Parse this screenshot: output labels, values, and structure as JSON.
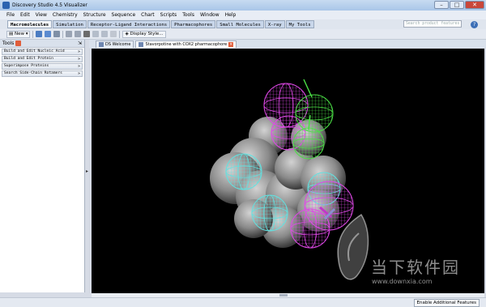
{
  "window": {
    "title": "Discovery Studio 4.5 Visualizer"
  },
  "menu": [
    "File",
    "Edit",
    "View",
    "Chemistry",
    "Structure",
    "Sequence",
    "Chart",
    "Scripts",
    "Tools",
    "Window",
    "Help"
  ],
  "tabs": [
    "Macromolecules",
    "Simulation",
    "Receptor-Ligand Interactions",
    "Pharmacophores",
    "Small Molecules",
    "X-ray",
    "My Tools"
  ],
  "search": {
    "placeholder": "Search product features"
  },
  "toolbar": {
    "new_label": "New",
    "display_style_label": "Display Style..."
  },
  "tools_panel": {
    "title": "Tools",
    "items": [
      "Build and Edit Nucleic Acid",
      "Build and Edit Protein",
      "Superimpose Proteins",
      "Search Side-Chain Rotamers"
    ]
  },
  "doc_tabs": [
    "DS Welcome",
    "Stavorpotine with COX2 pharmacophore"
  ],
  "status": {
    "enable_label": "Enable Additional Features"
  },
  "watermark": {
    "cn": "当下软件园",
    "url": "www.downxia.com"
  },
  "colors": {
    "viewer_bg": "#000000",
    "magenta": "#e048e8",
    "green": "#4be046",
    "cyan": "#62e1e0",
    "surface": "#a8a8a8"
  },
  "icons": [
    "app-icon",
    "help-icon",
    "close-icon",
    "pin-icon",
    "chevron-icon",
    "new-doc-icon",
    "open-icon",
    "save-icon",
    "undo-icon",
    "redo-icon"
  ]
}
